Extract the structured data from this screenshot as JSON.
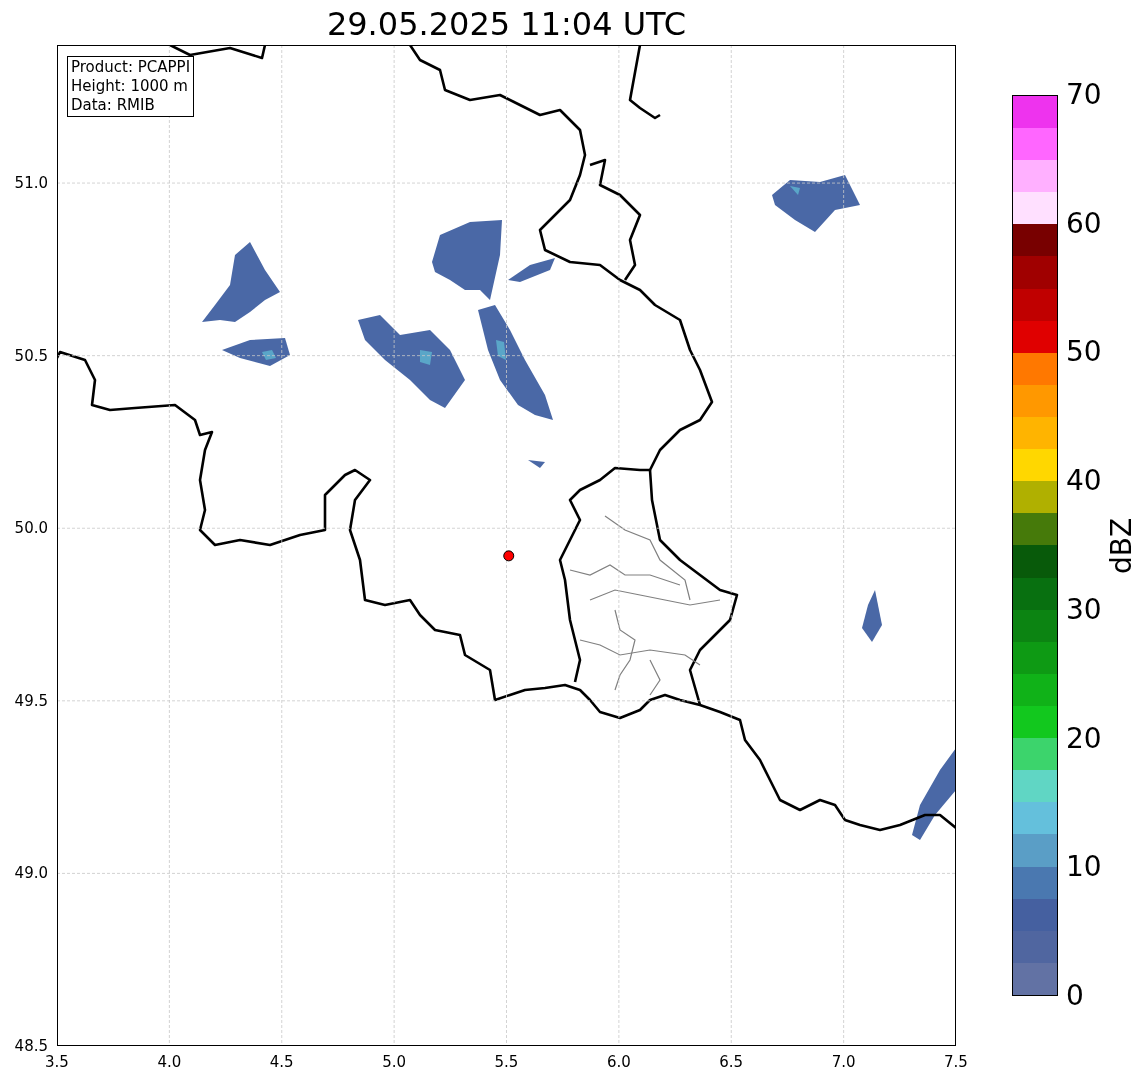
{
  "map": {
    "chart_data": {
      "type": "scatter",
      "title": "29.05.2025 11:04 UTC",
      "xlim": [
        3.5,
        7.5
      ],
      "ylim": [
        48.5,
        51.4
      ],
      "xticks": [
        {
          "value": 3.5,
          "label": "3.5"
        },
        {
          "value": 4,
          "label": "4.0"
        },
        {
          "value": 4.5,
          "label": "4.5"
        },
        {
          "value": 5,
          "label": "5.0"
        },
        {
          "value": 5.5,
          "label": "5.5"
        },
        {
          "value": 6,
          "label": "6.0"
        },
        {
          "value": 6.5,
          "label": "6.5"
        },
        {
          "value": 7,
          "label": "7.0"
        },
        {
          "value": 7.5,
          "label": "7.5"
        }
      ],
      "yticks": [
        {
          "value": 48.5,
          "label": "48.5"
        },
        {
          "value": 49,
          "label": "49.0"
        },
        {
          "value": 49.5,
          "label": "49.5"
        },
        {
          "value": 50,
          "label": "50.0"
        },
        {
          "value": 50.5,
          "label": "50.5"
        },
        {
          "value": 51,
          "label": "51.0"
        }
      ],
      "grid": true,
      "x": [
        5.51
      ],
      "series": [
        {
          "color": "#ff0000",
          "values": [
            49.92
          ]
        }
      ]
    },
    "info_box": [
      "Product: PCAPPI",
      "Height: 1000 m",
      "Data: RMIB"
    ]
  },
  "colorbar": {
    "label": "dBZ",
    "ticks": [
      "70",
      "60",
      "50",
      "40",
      "30",
      "20",
      "10",
      "0"
    ],
    "bins": [
      {
        "color": "#6272a4"
      },
      {
        "color": "#5066a0"
      },
      {
        "color": "#4560a0"
      },
      {
        "color": "#4a78b0"
      },
      {
        "color": "#5a9ec6"
      },
      {
        "color": "#64c0dc"
      },
      {
        "color": "#60d6c4"
      },
      {
        "color": "#3cd46c"
      },
      {
        "color": "#12c81e"
      },
      {
        "color": "#10b218"
      },
      {
        "color": "#0e9a14"
      },
      {
        "color": "#0c8412"
      },
      {
        "color": "#087010"
      },
      {
        "color": "#085a0a"
      },
      {
        "color": "#467a0a"
      },
      {
        "color": "#b0b000"
      },
      {
        "color": "#ffd700"
      },
      {
        "color": "#ffb400"
      },
      {
        "color": "#ff9800"
      },
      {
        "color": "#ff7800"
      },
      {
        "color": "#e00000"
      },
      {
        "color": "#c00000"
      },
      {
        "color": "#a00000"
      },
      {
        "color": "#780000"
      },
      {
        "color": "#ffe0ff"
      },
      {
        "color": "#ffb0ff"
      },
      {
        "color": "#ff66ff"
      },
      {
        "color": "#ee33ee"
      }
    ]
  }
}
